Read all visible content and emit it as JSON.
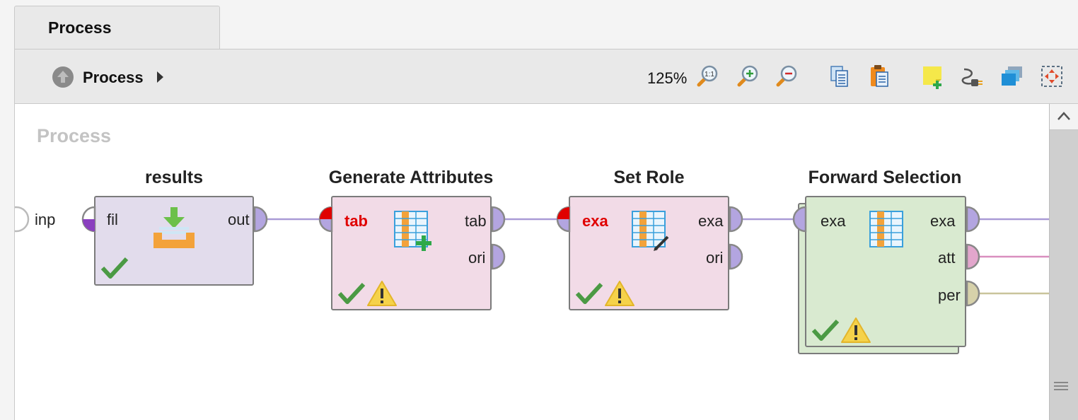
{
  "tab": {
    "label": "Process"
  },
  "toolbar": {
    "breadcrumb": "Process",
    "zoom": "125%",
    "icons": [
      "zoom-actual-size-icon",
      "zoom-in-icon",
      "zoom-out-icon",
      "copy-icon",
      "paste-icon",
      "add-note-icon",
      "auto-wire-icon",
      "layers-icon",
      "fit-to-window-icon"
    ]
  },
  "canvas": {
    "title": "Process",
    "inputs": [
      {
        "label": "inp"
      }
    ],
    "operators": [
      {
        "name": "results",
        "color": "#e2dcec",
        "ports_in": [
          {
            "label": "fil"
          }
        ],
        "ports_out": [
          {
            "label": "out"
          }
        ],
        "status": [
          "ok"
        ]
      },
      {
        "name": "Generate Attributes",
        "color": "#f2dbe7",
        "ports_in": [
          {
            "label": "tab",
            "error": true
          }
        ],
        "ports_out": [
          {
            "label": "tab"
          },
          {
            "label": "ori"
          }
        ],
        "status": [
          "ok",
          "warning"
        ]
      },
      {
        "name": "Set Role",
        "color": "#f2dbe7",
        "ports_in": [
          {
            "label": "exa",
            "error": true
          }
        ],
        "ports_out": [
          {
            "label": "exa"
          },
          {
            "label": "ori"
          }
        ],
        "status": [
          "ok",
          "warning"
        ]
      },
      {
        "name": "Forward Selection",
        "color": "#d9ead0",
        "ports_in": [
          {
            "label": "exa"
          }
        ],
        "ports_out": [
          {
            "label": "exa"
          },
          {
            "label": "att"
          },
          {
            "label": "per"
          }
        ],
        "status": [
          "ok",
          "warning"
        ]
      }
    ],
    "wire_colors": {
      "example_set": "#a99bd6",
      "attributes": "#d98fbf",
      "performance": "#c9c49b"
    }
  }
}
